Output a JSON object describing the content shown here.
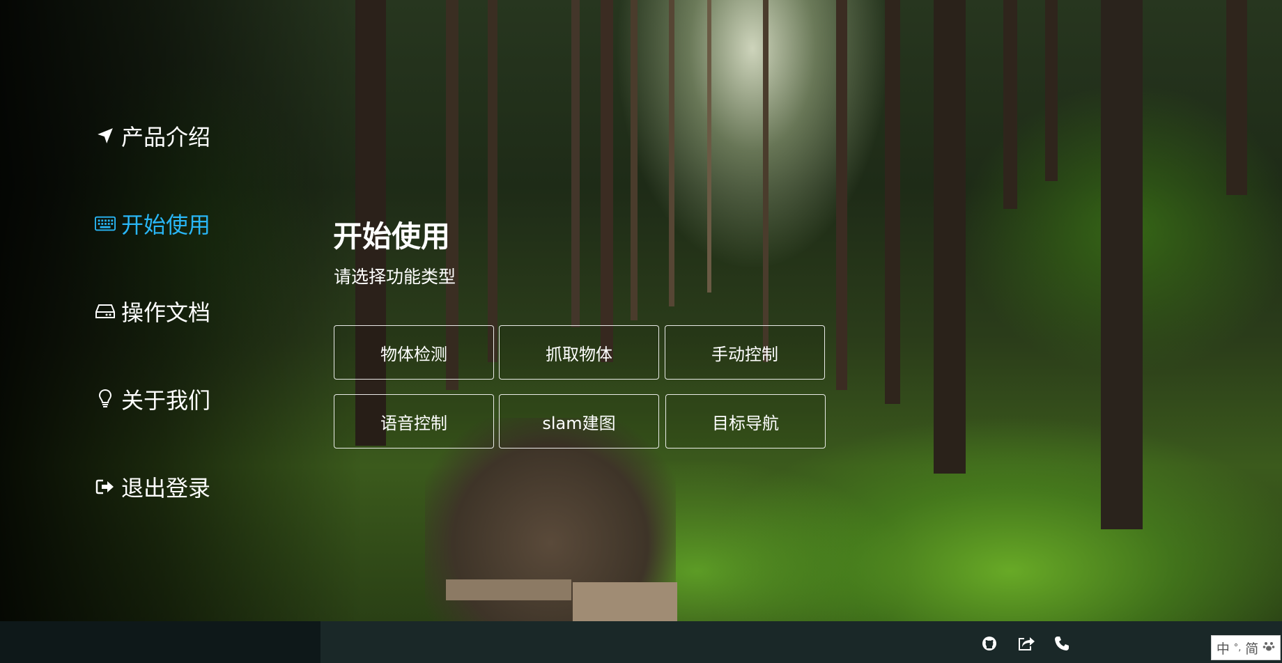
{
  "sidebar": {
    "items": [
      {
        "label": "产品介绍",
        "icon": "location-arrow-icon",
        "active": false
      },
      {
        "label": "开始使用",
        "icon": "keyboard-icon",
        "active": true
      },
      {
        "label": "操作文档",
        "icon": "hdd-icon",
        "active": false
      },
      {
        "label": "关于我们",
        "icon": "lightbulb-icon",
        "active": false
      },
      {
        "label": "退出登录",
        "icon": "sign-out-icon",
        "active": false
      }
    ],
    "active_color": "#29b6f6"
  },
  "main": {
    "title": "开始使用",
    "subtitle": "请选择功能类型",
    "buttons": [
      {
        "label": "物体检测"
      },
      {
        "label": "抓取物体"
      },
      {
        "label": "手动控制"
      },
      {
        "label": "语音控制"
      },
      {
        "label": "slam建图"
      },
      {
        "label": "目标导航"
      }
    ]
  },
  "footer": {
    "icons": [
      "github-icon",
      "share-icon",
      "phone-icon"
    ]
  },
  "ime": {
    "lang": "中",
    "dot": "°,",
    "mode": "简",
    "skin": "paw-icon"
  }
}
